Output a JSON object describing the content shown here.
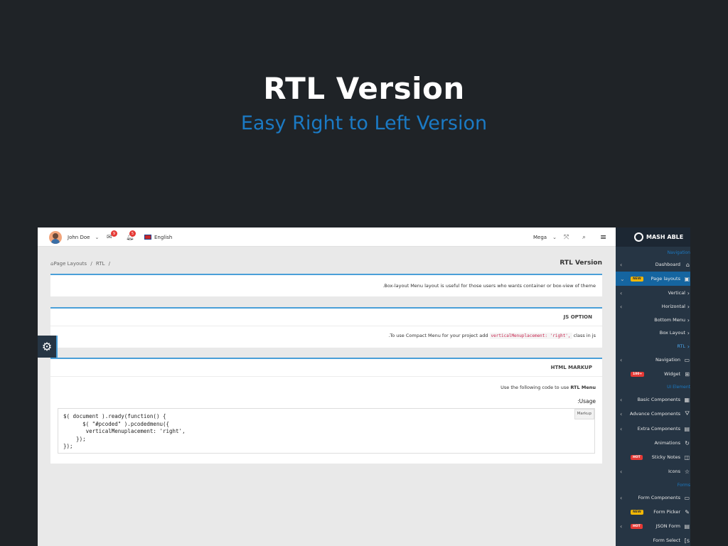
{
  "hero": {
    "title": "RTL Version",
    "subtitle": "Easy Right to Left Version"
  },
  "header": {
    "user_name": "John Doe",
    "messages_count": "9",
    "notifications_count": "5",
    "language": "English",
    "mega_label": "Mega"
  },
  "breadcrumb": {
    "home": "Page Layouts",
    "sep1": "/",
    "current": "RTL",
    "sep2": "/"
  },
  "page_title": "RTL Version",
  "cards": {
    "box_layout_text": ".Box-layout Menu layout is useful for those users who wants container or box-view of theme",
    "js_option": {
      "header": "JS OPTION",
      "text_prefix": ".To use Compact Menu for your project add",
      "code": "verticalMenuplacement: 'right',",
      "text_suffix": "class in js"
    },
    "html_markup": {
      "header": "HTML MARKUP",
      "text": "Use the following code to use",
      "text_bold": "RTL Menu",
      "usage_label": ":Usage",
      "markup_tag": "Markup",
      "code_lines": [
        "$( document ).ready(function() {",
        "      $( \"#pcoded\" ).pcodedmenu({",
        "       verticalMenuplacement: 'right',",
        "    });",
        "});"
      ]
    }
  },
  "sidebar": {
    "brand": "MASH ABLE",
    "captions": [
      "Navigation",
      "UI Element",
      "Forms"
    ],
    "items": [
      {
        "label": "Dashboard"
      },
      {
        "label": "Page layouts",
        "tag": "NEW"
      },
      {
        "label": "Vertical"
      },
      {
        "label": "Horizontal"
      },
      {
        "label": "Bottom Menu"
      },
      {
        "label": "Box Layout"
      },
      {
        "label": "RTL"
      },
      {
        "label": "Navigation"
      },
      {
        "label": "Widget",
        "tag": "100+"
      },
      {
        "label": "Basic Components"
      },
      {
        "label": "Advance Components"
      },
      {
        "label": "Extra Components"
      },
      {
        "label": "Animations"
      },
      {
        "label": "Sticky Notes",
        "tag": "HOT"
      },
      {
        "label": "Icons"
      },
      {
        "label": "Form Components"
      },
      {
        "label": "Form Picker",
        "tag": "NEW"
      },
      {
        "label": "JSON Form",
        "tag": "HOT"
      },
      {
        "label": "Form Select"
      }
    ]
  },
  "colors": {
    "background": "#1f2327",
    "accent": "#1b7ac4",
    "sidebar": "#263544"
  }
}
